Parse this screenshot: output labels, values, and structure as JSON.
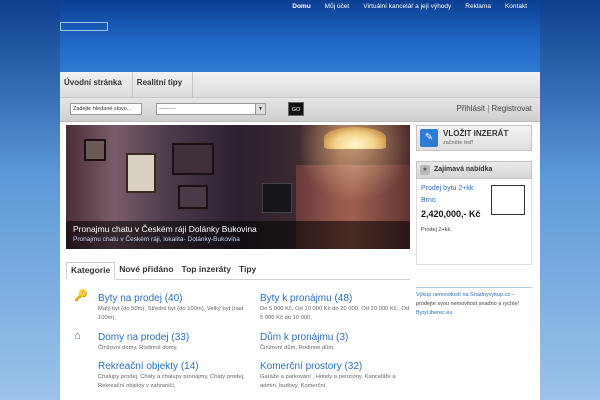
{
  "topnav": [
    "Domu",
    "Můj účet",
    "Virtuální kancelář a její výhody",
    "Reklama",
    "Kontakt"
  ],
  "mainnav": [
    "Úvodní stránka",
    "Realitní tipy"
  ],
  "search": {
    "placeholder": "Zadejte hledané slovo...",
    "select_value": "---------",
    "go_label": "GO"
  },
  "login": {
    "prihlasit": "Přihlásit",
    "separator": "|",
    "registrovat": "Registrovat"
  },
  "featured": {
    "title": "Pronajmu chatu v Českém ráji Dolánky Bukovina",
    "subtitle": "Pronajmu chatu v Českém ráji, lokalita- Dolánky-Bukovina"
  },
  "cat_tabs": [
    "Kategorie",
    "Nové přidáno",
    "Top inzeráty",
    "Tipy"
  ],
  "categories": [
    {
      "title": "Byty na prodej (40)",
      "sub": "Malý byt (do 50m), Střední byt (do 100m), Velký byt (nad 100m),"
    },
    {
      "title": "Byty k pronájmu (48)",
      "sub": "Do 5 000 Kč, Od 10 000 Kč do 20 000, Od 20 000 Kč., Od 5 000 Kč do 10 000,"
    },
    {
      "title": "Domy na prodej (33)",
      "sub": "Činžovní domy, Rodinné domy,"
    },
    {
      "title": "Dům k pronájmu (3)",
      "sub": "Činžovní dům, Rodinné dům,"
    },
    {
      "title": "Rekreační objekty (14)",
      "sub": "Chalupy prodej, Chaty a chalupy pronájmy, Chaty prodej, Rekreační objekty v zahraničí,"
    },
    {
      "title": "Komerční prostory (32)",
      "sub": "Garáže a parkování , Hotely a penziony, Kanceláře a admin. budovy, Komerční"
    }
  ],
  "sidebar": {
    "vlozit_title": "VLOŽIT INZERÁT",
    "vlozit_sub": "začněte teď!",
    "zajimava_title": "Zajímavá nabídka",
    "offer_title": "Prodej bytu 2+kk Brno",
    "offer_price": "2,420,000,- Kč",
    "offer_desc": "Prodej 2+kk.",
    "ad_link1": "Výkup nemovitostí na Snadnyvykup.cz –",
    "ad_text": "prodejte svou nemovitost snadno a rychle!",
    "ad_link2": "BytyLiberec.eu"
  },
  "icons": {
    "key": "key-icon",
    "house": "house-icon",
    "vlozit": "add-ad-icon",
    "zajimava": "star-icon"
  },
  "colors": {
    "link": "#2a6fc0",
    "header_blue": "#1f66c4"
  }
}
